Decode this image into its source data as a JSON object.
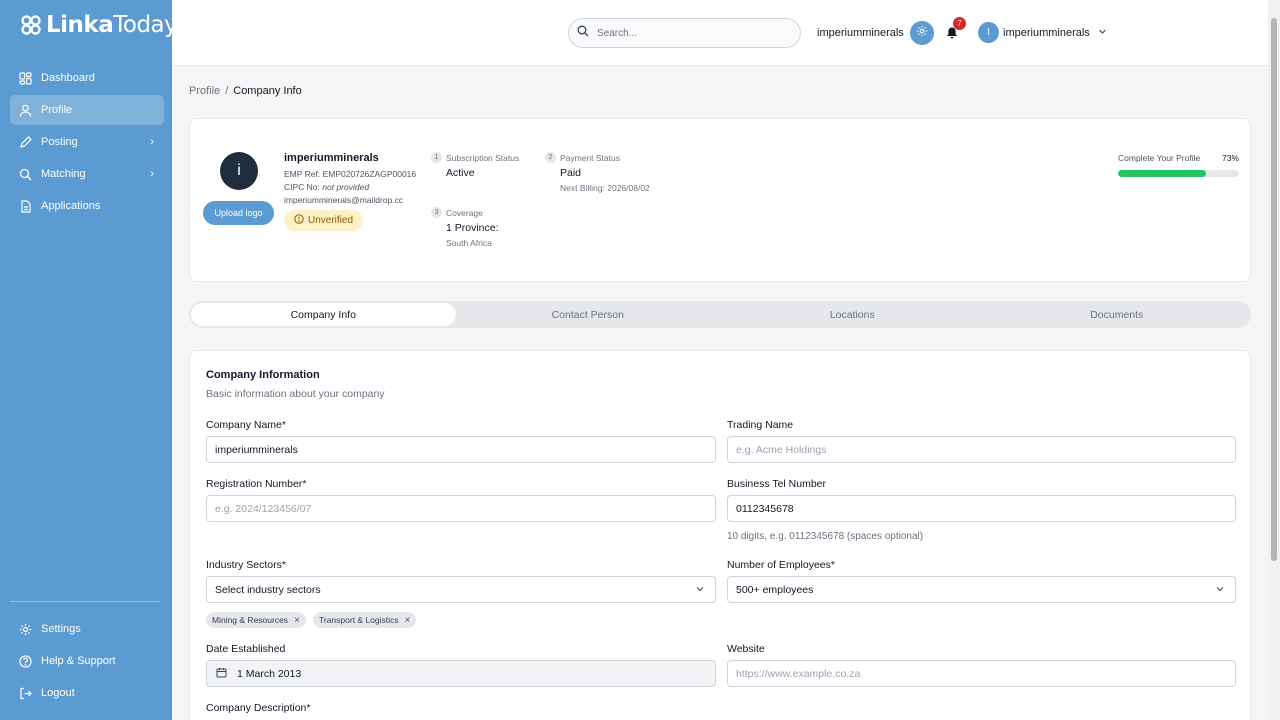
{
  "app": {
    "logo_text": "LinkaToday",
    "logo_bold": "Linka",
    "logo_light": "Today"
  },
  "sidebar": {
    "items": [
      {
        "label": "Dashboard",
        "icon": "dashboard-icon"
      },
      {
        "label": "Profile",
        "icon": "user-icon",
        "active": true
      },
      {
        "label": "Posting",
        "icon": "pencil-icon",
        "has_chevron": true
      },
      {
        "label": "Matching",
        "icon": "search-icon",
        "has_chevron": true
      },
      {
        "label": "Applications",
        "icon": "document-icon"
      }
    ],
    "bottom_items": [
      {
        "label": "Settings",
        "icon": "gear-icon"
      },
      {
        "label": "Help & Support",
        "icon": "help-icon"
      },
      {
        "label": "Logout",
        "icon": "logout-icon"
      }
    ]
  },
  "topbar": {
    "search_placeholder": "Search...",
    "company_name": "imperiumminerals",
    "notification_count": "7",
    "avatar_initial": "I",
    "user_name": "imperiumminerals"
  },
  "breadcrumb": {
    "parent": "Profile",
    "separator": "/",
    "current": "Company Info"
  },
  "profile": {
    "avatar_initial": "i",
    "upload_label": "Upload logo",
    "name": "imperiumminerals",
    "emp_ref": "EMP Ref: EMP020726ZAGP00016",
    "cipc_label": "CIPC No:",
    "cipc_value": "not provided",
    "email": "imperiumminerals@maildrop.cc",
    "verification": "Unverified",
    "subscription": {
      "num": "1",
      "label": "Subscription Status",
      "value": "Active"
    },
    "payment": {
      "num": "2",
      "label": "Payment Status",
      "value": "Paid",
      "sub": "Next Billing: 2026/08/02"
    },
    "coverage": {
      "num": "3",
      "label": "Coverage",
      "value": "1 Province:",
      "sub": "South Africa"
    },
    "completion_label": "Complete Your Profile",
    "completion_text": "73%",
    "completion_fraction": 0.73
  },
  "tabs": [
    {
      "label": "Company Info",
      "active": true
    },
    {
      "label": "Contact Person"
    },
    {
      "label": "Locations"
    },
    {
      "label": "Documents"
    }
  ],
  "form": {
    "title": "Company Information",
    "subtitle": "Basic information about your company",
    "company_name": {
      "label": "Company Name*",
      "value": "imperiumminerals"
    },
    "trading_name": {
      "label": "Trading Name",
      "placeholder": "e.g. Acme Holdings",
      "value": ""
    },
    "registration": {
      "label": "Registration Number*",
      "placeholder": "e.g. 2024/123456/07",
      "value": ""
    },
    "business_tel": {
      "label": "Business Tel Number",
      "value": "0112345678",
      "help": "10 digits, e.g. 0112345678 (spaces optional)"
    },
    "industry": {
      "label": "Industry Sectors*",
      "placeholder": "Select industry sectors",
      "chips": [
        "Mining & Resources",
        "Transport & Logistics"
      ]
    },
    "employees": {
      "label": "Number of Employees*",
      "value": "500+ employees"
    },
    "date_established": {
      "label": "Date Established",
      "value": "1 March 2013"
    },
    "website": {
      "label": "Website",
      "placeholder": "https://www.example.co.za",
      "value": ""
    },
    "description": {
      "label": "Company Description*"
    }
  },
  "colors": {
    "sidebar": "#5b9bd1",
    "progress": "#22c55e",
    "badge": "#dc2626",
    "unverified_bg": "#fdf1c7"
  }
}
